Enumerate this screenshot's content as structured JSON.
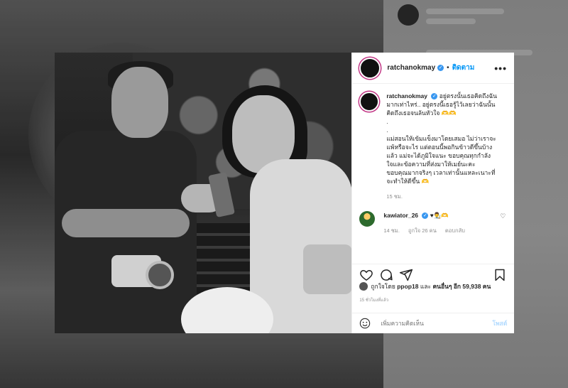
{
  "post": {
    "username": "ratchanokmay",
    "follow_label": "ติดตาม",
    "more_label": "•••",
    "caption_lines": [
      "อยู่ตรงนั้นเธอคิดถึงฉัน",
      "มากเท่าไหร่.. อยู่ตรงนี้เธอรู้ไว้เลยว่าฉันนั้น",
      "คิดถึงเธอจนล้นหัวใจ 🫶🫶",
      ".",
      ".",
      "แม่สอนให้เข้มแข็งมาโดยเสมอ ไม่ว่าเราจะ",
      "แพ้หรือจะไร แต่ตอนนี้พอกินข้าวดีขึ้นบ้าง",
      "แล้ว แม่จะได้ภูมิใจแนะ ขอบคุณทุกกำลัง",
      "ใจและข้อความที่ส่งมาให้เมย์นะคะ",
      "ขอบคุณมากจริงๆ เวลาเท่านั้นแหละเนาะที่",
      "จะทำให้ดีขึ้น 🫶"
    ],
    "caption_time": "15 ชม.",
    "comment": {
      "username": "kawiator_26",
      "text": "♥👨‍🎨🫶",
      "time": "14 ชม.",
      "likes": "ถูกใจ 26 คน",
      "reply": "ตอบกลับ"
    },
    "likes_prefix": "ถูกใจโดย",
    "likes_user": "ppop18",
    "likes_and": "และ",
    "likes_others": "คนอื่นๆ อีก 59,938 คน",
    "timestamp": "15 ชั่วโมงที่แล้ว",
    "add_comment_placeholder": "เพิ่มความคิดเห็น",
    "post_label": "โพสต์"
  },
  "icons": {
    "like": "heart-icon",
    "comment": "comment-icon",
    "share": "share-icon",
    "save": "bookmark-icon",
    "emoji": "emoji-icon",
    "verified": "verified-icon"
  },
  "colors": {
    "link": "#0095f6",
    "verified": "#3897f0",
    "muted": "#8e8e8e",
    "post_disabled": "#b3dbff"
  }
}
